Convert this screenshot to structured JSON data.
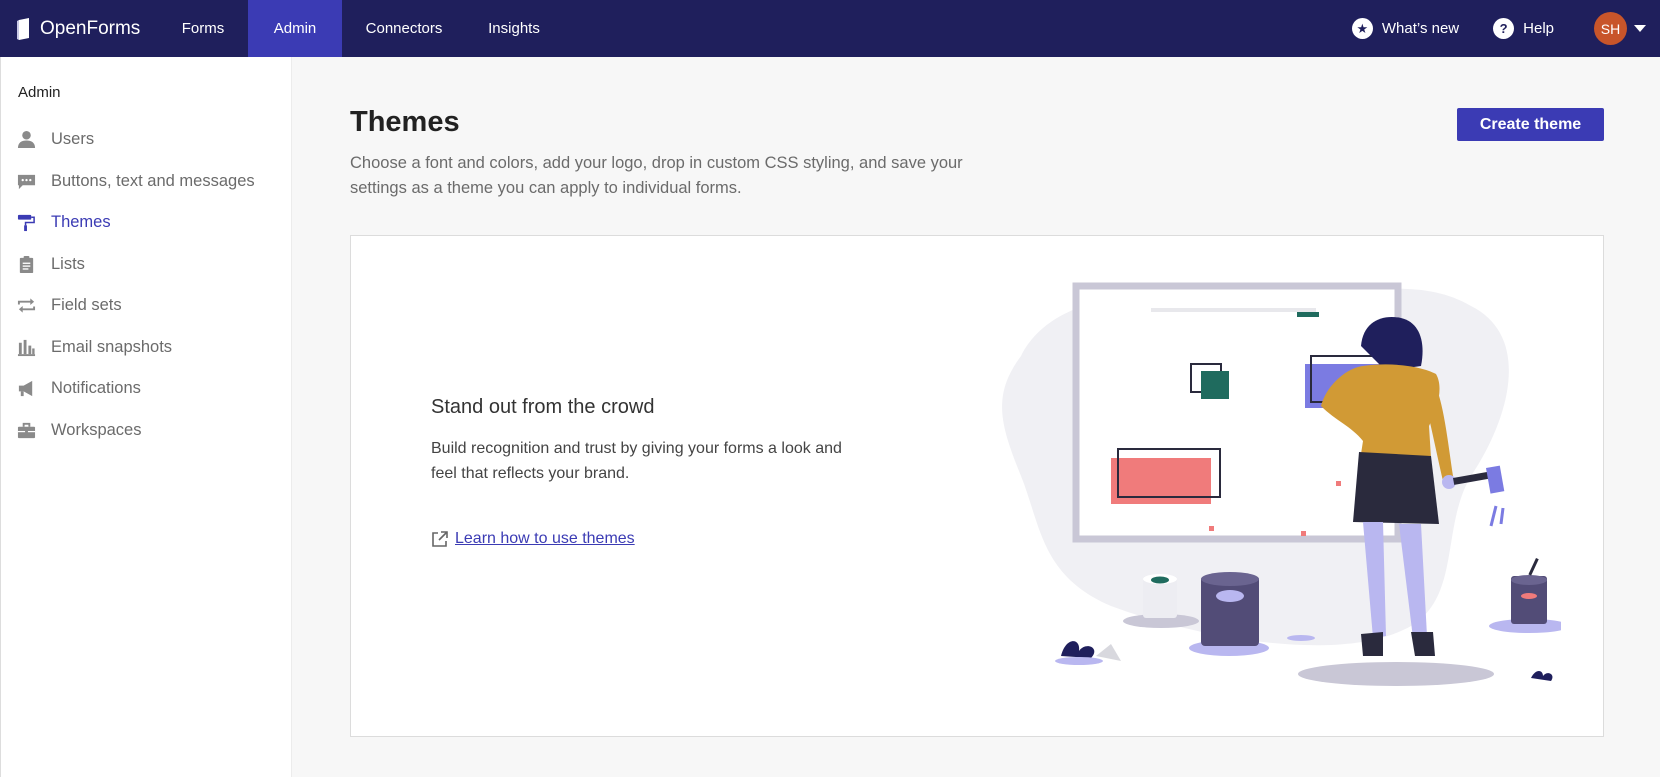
{
  "app": {
    "brand": "OpenForms",
    "nav": [
      {
        "label": "Forms"
      },
      {
        "label": "Admin"
      },
      {
        "label": "Connectors"
      },
      {
        "label": "Insights"
      }
    ],
    "whats_new": "What’s new",
    "help": "Help",
    "user_initials": "SH"
  },
  "sidebar": {
    "title": "Admin",
    "items": [
      {
        "label": "Users",
        "icon": "user-icon"
      },
      {
        "label": "Buttons, text and messages",
        "icon": "message-icon"
      },
      {
        "label": "Themes",
        "icon": "paint-roller-icon"
      },
      {
        "label": "Lists",
        "icon": "clipboard-icon"
      },
      {
        "label": "Field sets",
        "icon": "repeat-icon"
      },
      {
        "label": "Email snapshots",
        "icon": "bar-chart-icon"
      },
      {
        "label": "Notifications",
        "icon": "megaphone-icon"
      },
      {
        "label": "Workspaces",
        "icon": "briefcase-icon"
      }
    ]
  },
  "main": {
    "title": "Themes",
    "description": "Choose a font and colors, add your logo, drop in custom CSS styling, and save your settings as a theme you can apply to individual forms.",
    "create_button": "Create theme",
    "card": {
      "title": "Stand out from the crowd",
      "text": "Build recognition and trust by giving your forms a look and feel that reflects your brand.",
      "link": "Learn how to use themes"
    }
  },
  "colors": {
    "nav_bg": "#1f1f5c",
    "accent": "#3b3bb4",
    "avatar": "#c8552a"
  }
}
